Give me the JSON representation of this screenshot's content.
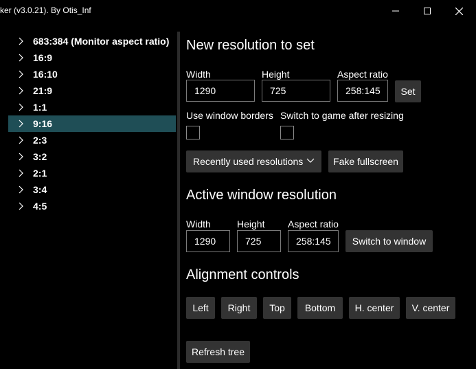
{
  "window": {
    "title": "ker (v3.0.21). By Otis_Inf",
    "minimize_icon": "minimize-icon",
    "maximize_icon": "maximize-icon",
    "close_icon": "close-icon"
  },
  "tree": {
    "items": [
      {
        "label": "683:384 (Monitor aspect ratio)",
        "selected": false
      },
      {
        "label": "16:9",
        "selected": false
      },
      {
        "label": "16:10",
        "selected": false
      },
      {
        "label": "21:9",
        "selected": false
      },
      {
        "label": "1:1",
        "selected": false
      },
      {
        "label": "9:16",
        "selected": true
      },
      {
        "label": "2:3",
        "selected": false
      },
      {
        "label": "3:2",
        "selected": false
      },
      {
        "label": "2:1",
        "selected": false
      },
      {
        "label": "3:4",
        "selected": false
      },
      {
        "label": "4:5",
        "selected": false
      }
    ],
    "selected_color": "#1f4e56"
  },
  "new_resolution": {
    "heading": "New resolution to set",
    "width_label": "Width",
    "width_value": "1290",
    "height_label": "Height",
    "height_value": "725",
    "aspect_label": "Aspect ratio",
    "aspect_value": "258:145",
    "set_label": "Set",
    "use_borders_label": "Use window borders",
    "switch_after_label": "Switch to game after resizing",
    "recent_label": "Recently used resolutions",
    "fake_fullscreen_label": "Fake fullscreen"
  },
  "active_resolution": {
    "heading": "Active window resolution",
    "width_label": "Width",
    "width_value": "1290",
    "height_label": "Height",
    "height_value": "725",
    "aspect_label": "Aspect ratio",
    "aspect_value": "258:145",
    "switch_label": "Switch to window"
  },
  "alignment": {
    "heading": "Alignment controls",
    "left": "Left",
    "right": "Right",
    "top": "Top",
    "bottom": "Bottom",
    "hcenter": "H. center",
    "vcenter": "V. center"
  },
  "refresh_label": "Refresh tree"
}
